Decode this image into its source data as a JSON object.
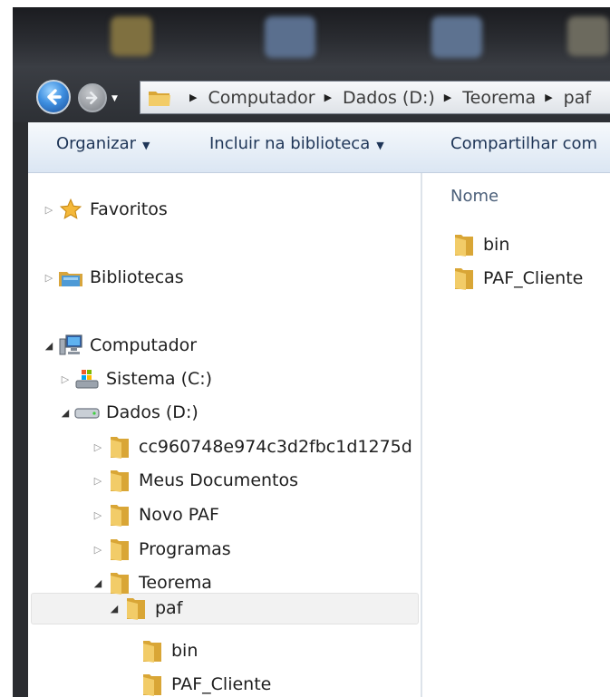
{
  "address_bar": {
    "crumbs": [
      "Computador",
      "Dados (D:)",
      "Teorema",
      "paf"
    ]
  },
  "toolbar": {
    "organize": "Organizar",
    "include_library": "Incluir na biblioteca",
    "share": "Compartilhar com"
  },
  "nav_tree": {
    "favorites": "Favoritos",
    "libraries": "Bibliotecas",
    "computer": "Computador",
    "sistema": "Sistema (C:)",
    "dados": "Dados (D:)",
    "dados_children": [
      "cc960748e974c3d2fbc1d1275d",
      "Meus Documentos",
      "Novo PAF",
      "Programas",
      "Teorema"
    ],
    "selected": "paf",
    "paf_children": [
      "bin",
      "PAF_Cliente"
    ]
  },
  "content": {
    "column_header": "Nome",
    "items": [
      "bin",
      "PAF_Cliente"
    ]
  },
  "colors": {
    "toolbar_text": "#1e3557",
    "column_header": "#4c607a",
    "folder": "#e8b84a",
    "selection": "#f2f2f2"
  }
}
